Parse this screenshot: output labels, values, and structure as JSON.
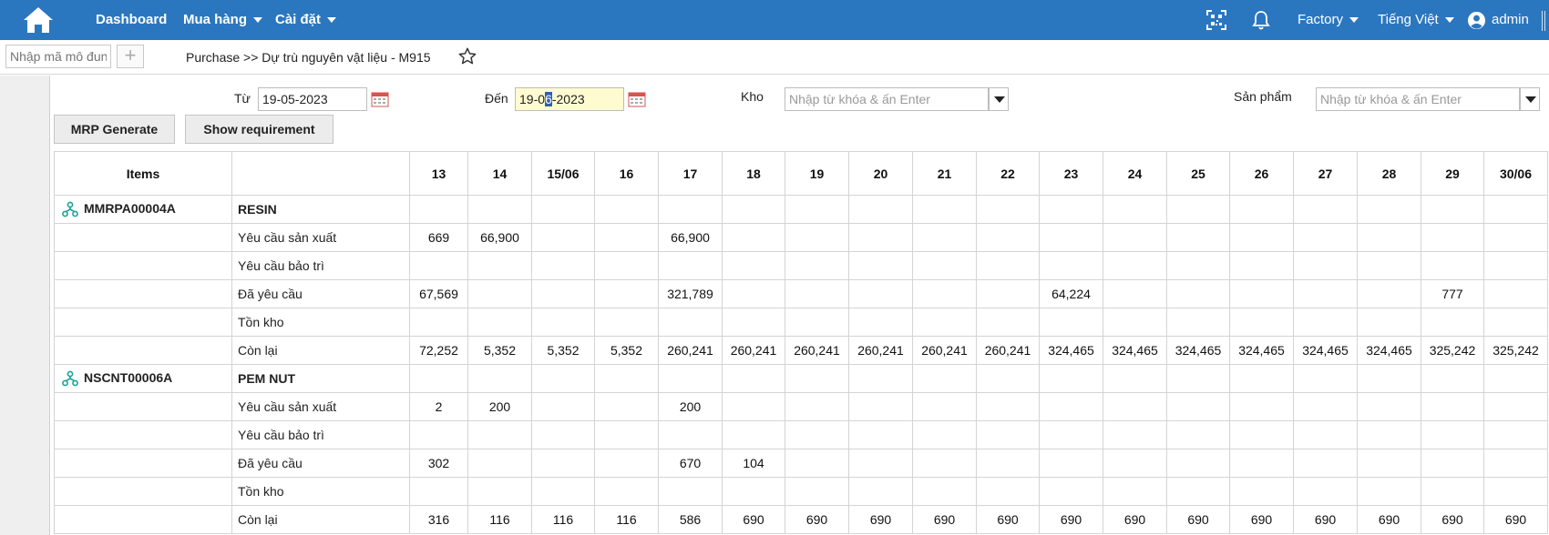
{
  "nav": {
    "dashboard": "Dashboard",
    "purchase": "Mua hàng",
    "settings": "Cài đặt",
    "factory": "Factory",
    "language": "Tiếng Việt",
    "user": "admin",
    "bar_color": "#2b77bf"
  },
  "crumbbar": {
    "module_placeholder": "Nhập mã mô đun",
    "add_symbol": "+",
    "breadcrumb": "Purchase >> Dự trù nguyên vật liệu - M915"
  },
  "filters": {
    "from_label": "Từ",
    "from_value": "19-05-2023",
    "to_label": "Đến",
    "to_value_pre": "19-0",
    "to_value_sel": "6",
    "to_value_post": "-2023",
    "warehouse_label": "Kho",
    "warehouse_placeholder": "Nhập từ khóa & ấn Enter",
    "product_label": "Sản phẩm",
    "product_placeholder": "Nhập từ khóa & ấn Enter"
  },
  "actions": {
    "mrp_generate": "MRP Generate",
    "show_requirement": "Show requirement"
  },
  "grid": {
    "items_header": "Items",
    "desc_header": "",
    "days": [
      "13",
      "14",
      "15/06",
      "16",
      "17",
      "18",
      "19",
      "20",
      "21",
      "22",
      "23",
      "24",
      "25",
      "26",
      "27",
      "28",
      "29",
      "30/06"
    ],
    "groups": [
      {
        "code": "MMRPA00004A",
        "name": "RESIN",
        "rows": [
          {
            "label": "Yêu cầu sản xuất",
            "values": [
              "669",
              "66,900",
              "",
              "",
              "66,900",
              "",
              "",
              "",
              "",
              "",
              "",
              "",
              "",
              "",
              "",
              "",
              "",
              ""
            ]
          },
          {
            "label": "Yêu cầu bảo trì",
            "values": [
              "",
              "",
              "",
              "",
              "",
              "",
              "",
              "",
              "",
              "",
              "",
              "",
              "",
              "",
              "",
              "",
              "",
              ""
            ]
          },
          {
            "label": "Đã yêu cầu",
            "values": [
              "67,569",
              "",
              "",
              "",
              "321,789",
              "",
              "",
              "",
              "",
              "",
              "64,224",
              "",
              "",
              "",
              "",
              "",
              "777",
              ""
            ]
          },
          {
            "label": "Tồn kho",
            "values": [
              "",
              "",
              "",
              "",
              "",
              "",
              "",
              "",
              "",
              "",
              "",
              "",
              "",
              "",
              "",
              "",
              "",
              ""
            ]
          },
          {
            "label": "Còn lại",
            "values": [
              "72,252",
              "5,352",
              "5,352",
              "5,352",
              "260,241",
              "260,241",
              "260,241",
              "260,241",
              "260,241",
              "260,241",
              "324,465",
              "324,465",
              "324,465",
              "324,465",
              "324,465",
              "324,465",
              "325,242",
              "325,242"
            ]
          }
        ]
      },
      {
        "code": "NSCNT00006A",
        "name": "PEM NUT",
        "rows": [
          {
            "label": "Yêu cầu sản xuất",
            "values": [
              "2",
              "200",
              "",
              "",
              "200",
              "",
              "",
              "",
              "",
              "",
              "",
              "",
              "",
              "",
              "",
              "",
              "",
              ""
            ]
          },
          {
            "label": "Yêu cầu bảo trì",
            "values": [
              "",
              "",
              "",
              "",
              "",
              "",
              "",
              "",
              "",
              "",
              "",
              "",
              "",
              "",
              "",
              "",
              "",
              ""
            ]
          },
          {
            "label": "Đã yêu cầu",
            "values": [
              "302",
              "",
              "",
              "",
              "670",
              "104",
              "",
              "",
              "",
              "",
              "",
              "",
              "",
              "",
              "",
              "",
              "",
              ""
            ]
          },
          {
            "label": "Tồn kho",
            "values": [
              "",
              "",
              "",
              "",
              "",
              "",
              "",
              "",
              "",
              "",
              "",
              "",
              "",
              "",
              "",
              "",
              "",
              ""
            ]
          },
          {
            "label": "Còn lại",
            "values": [
              "316",
              "116",
              "116",
              "116",
              "586",
              "690",
              "690",
              "690",
              "690",
              "690",
              "690",
              "690",
              "690",
              "690",
              "690",
              "690",
              "690",
              "690"
            ]
          }
        ]
      }
    ]
  }
}
